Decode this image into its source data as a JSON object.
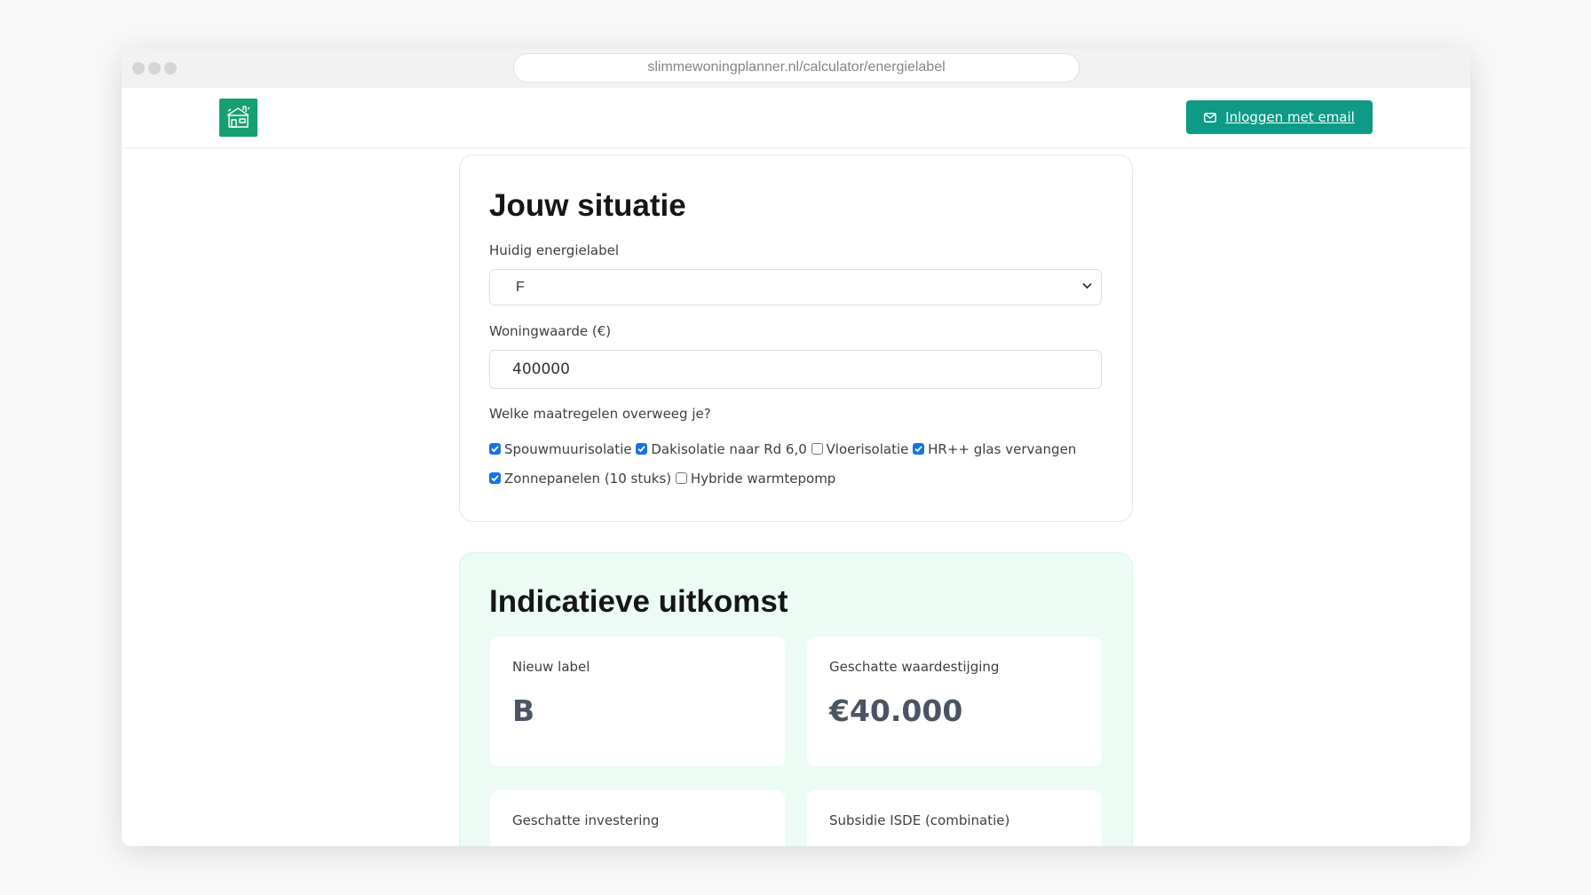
{
  "browser": {
    "url": "slimmewoningplanner.nl/calculator/energielabel"
  },
  "header": {
    "logo_icon": "house-icon",
    "login_label": "Inloggen met email",
    "login_icon": "mail-icon",
    "accent_color": "#0d9a86",
    "logo_color": "#16a06f"
  },
  "situation": {
    "title": "Jouw situatie",
    "label_field": {
      "label": "Huidig energielabel",
      "value": "F"
    },
    "value_field": {
      "label": "Woningwaarde (€)",
      "value": "400000"
    },
    "measures": {
      "label": "Welke maatregelen overweeg je?",
      "options": [
        {
          "label": "Spouwmuurisolatie",
          "checked": true
        },
        {
          "label": "Dakisolatie naar Rd 6,0",
          "checked": true
        },
        {
          "label": "Vloerisolatie",
          "checked": false
        },
        {
          "label": "HR++ glas vervangen",
          "checked": true
        },
        {
          "label": "Zonnepanelen (10 stuks)",
          "checked": true
        },
        {
          "label": "Hybride warmtepomp",
          "checked": false
        }
      ]
    }
  },
  "result": {
    "title": "Indicatieve uitkomst",
    "background_color": "#ecfcf4",
    "tiles": [
      {
        "label": "Nieuw label",
        "value": "B"
      },
      {
        "label": "Geschatte waardestijging",
        "value": "€40.000"
      },
      {
        "label": "Geschatte investering",
        "value": ""
      },
      {
        "label": "Subsidie ISDE (combinatie)",
        "value": ""
      }
    ]
  }
}
